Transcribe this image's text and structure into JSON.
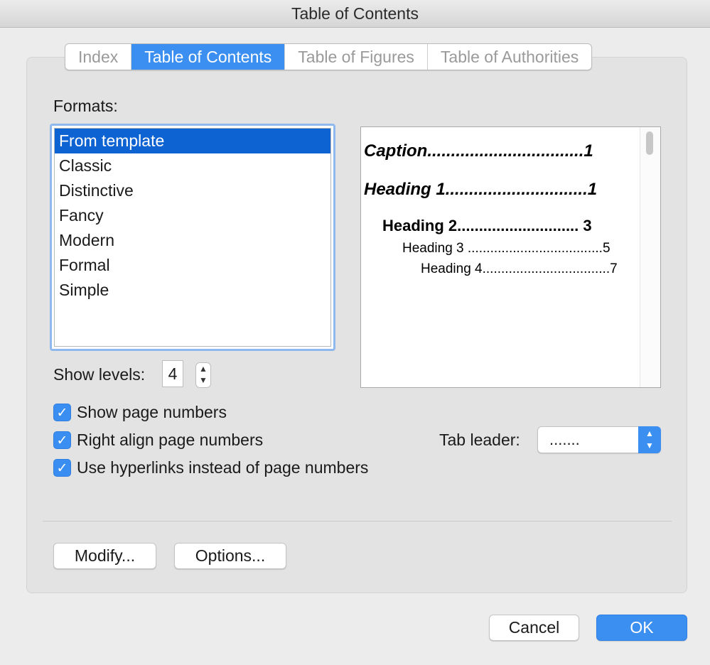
{
  "window": {
    "title": "Table of Contents"
  },
  "tabs": [
    "Index",
    "Table of Contents",
    "Table of Figures",
    "Table of Authorities"
  ],
  "active_tab": "Table of Contents",
  "formats": {
    "label": "Formats:",
    "items": [
      "From template",
      "Classic",
      "Distinctive",
      "Fancy",
      "Modern",
      "Formal",
      "Simple"
    ],
    "selected": "From template"
  },
  "preview": {
    "lines": [
      {
        "text": "Caption.................................1"
      },
      {
        "text": "Heading 1..............................1"
      },
      {
        "text": "Heading 2............................ 3"
      },
      {
        "text": "Heading 3 ....................................5"
      },
      {
        "text": "Heading 4..................................7"
      }
    ]
  },
  "show_levels": {
    "label": "Show levels:",
    "value": "4"
  },
  "options": {
    "show_page_numbers": {
      "label": "Show page numbers",
      "checked": true
    },
    "right_align": {
      "label": "Right align page numbers",
      "checked": true
    },
    "hyperlinks": {
      "label": "Use hyperlinks instead of page numbers",
      "checked": true
    }
  },
  "tab_leader": {
    "label": "Tab leader:",
    "value": "......."
  },
  "buttons": {
    "modify": "Modify...",
    "options": "Options...",
    "cancel": "Cancel",
    "ok": "OK"
  },
  "colors": {
    "accent": "#3b8ff0",
    "selection": "#0e63d3"
  }
}
